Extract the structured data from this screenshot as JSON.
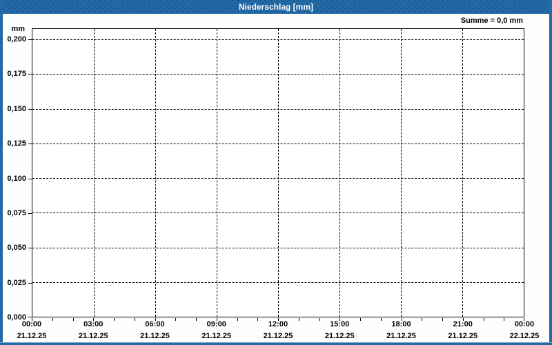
{
  "window": {
    "title": "Niederschlag [mm]"
  },
  "header": {
    "sum_label": "Summe = 0,0 mm"
  },
  "colors": {
    "accent_blue": "#2269a6",
    "plot_background": "#fefffe",
    "grid": "#000000",
    "title_text": "#ffffff",
    "label_text": "#000000"
  },
  "chart_data": {
    "type": "bar",
    "title": "Niederschlag [mm]",
    "ylabel": "mm",
    "ylim": [
      0,
      0.2083
    ],
    "grid_max_value": 0.2,
    "grid": true,
    "ytick_values": [
      0,
      0.025,
      0.05,
      0.075,
      0.1,
      0.125,
      0.15,
      0.175,
      0.2
    ],
    "ytick_labels": [
      "0,000",
      "0,025",
      "0,050",
      "0,075",
      "0,100",
      "0,125",
      "0,150",
      "0,175",
      "0,200"
    ],
    "x_range_hours": [
      0,
      24
    ],
    "xtick_hours": [
      0,
      3,
      6,
      9,
      12,
      15,
      18,
      21,
      24
    ],
    "xtick_time_labels": [
      "00:00",
      "03:00",
      "06:00",
      "09:00",
      "12:00",
      "15:00",
      "18:00",
      "21:00",
      "00:00"
    ],
    "xtick_date_labels": [
      "21.12.25",
      "21.12.25",
      "21.12.25",
      "21.12.25",
      "21.12.25",
      "21.12.25",
      "21.12.25",
      "21.12.25",
      "22.12.25"
    ],
    "x_minor_tick_step_hours": 1,
    "series": [
      {
        "name": "Niederschlag",
        "values": []
      }
    ],
    "annotations": [
      "Summe = 0,0 mm"
    ],
    "legend": "none"
  }
}
